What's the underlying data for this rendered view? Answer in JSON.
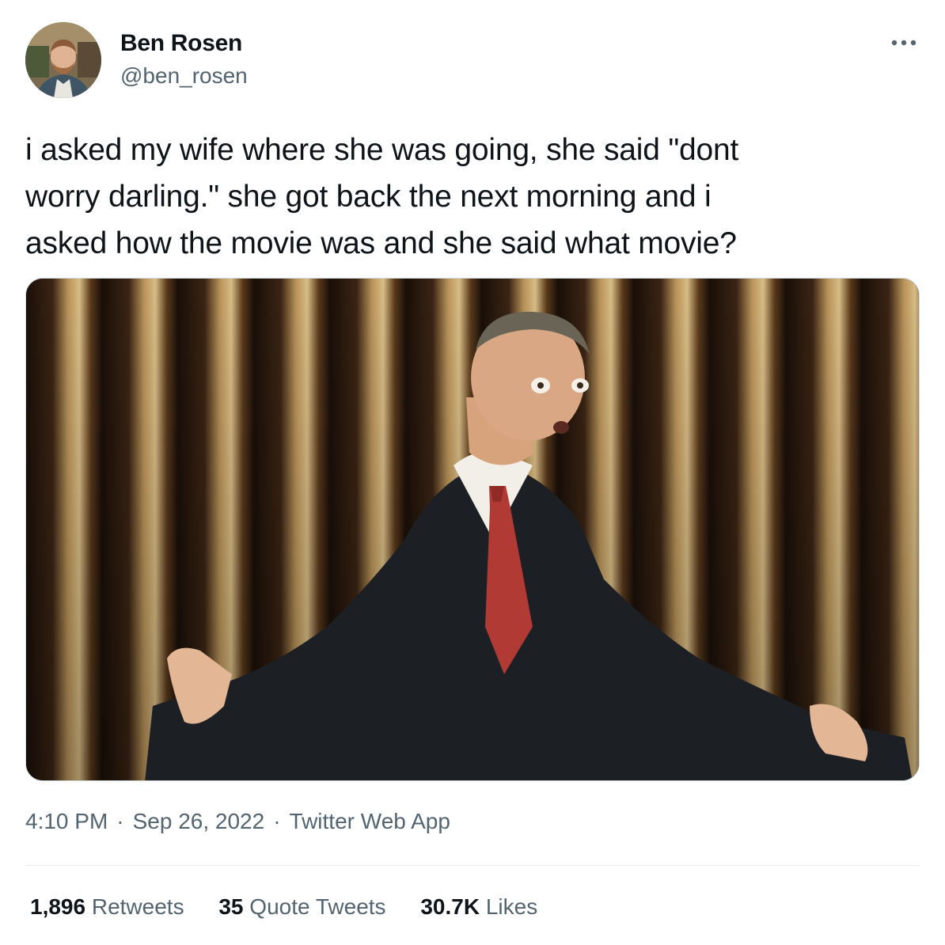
{
  "author": {
    "name": "Ben Rosen",
    "handle": "@ben_rosen"
  },
  "icons": {
    "avatar": "avatar-photo",
    "more": "more-options-icon"
  },
  "tweet": {
    "text": "i asked my wife where she was going, she said \"dont\nworry darling.\" she got back the next morning and i\nasked how the movie was and she said what movie?"
  },
  "meta": {
    "time": "4:10 PM",
    "separator": "·",
    "date": "Sep 26, 2022",
    "source": "Twitter Web App"
  },
  "stats": {
    "retweets_count": "1,896",
    "retweets_label": "Retweets",
    "quote_count": "35",
    "quote_label": "Quote Tweets",
    "likes_count": "30.7K",
    "likes_label": "Likes"
  },
  "colors": {
    "text": "#0f1419",
    "secondary": "#536471",
    "border": "#cfd9de",
    "divider": "#e6ecf0"
  }
}
